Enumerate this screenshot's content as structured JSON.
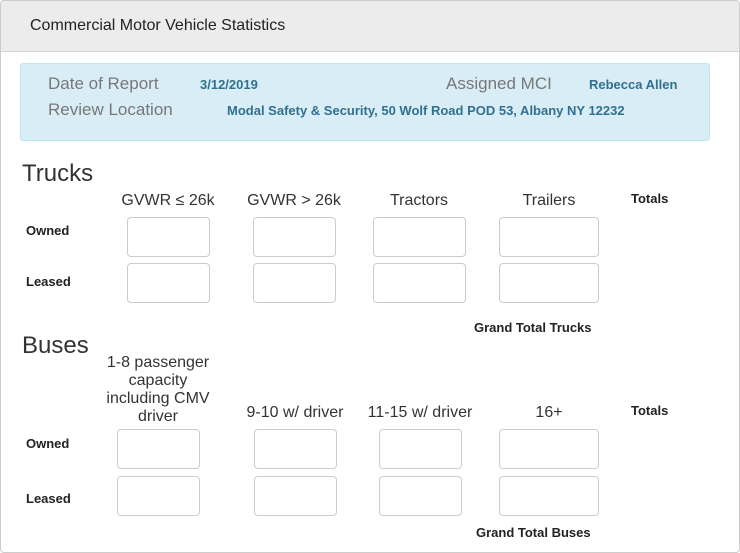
{
  "title": "Commercial Motor Vehicle Statistics",
  "info": {
    "date_label": "Date of Report",
    "date_value": "3/12/2019",
    "mci_label": "Assigned MCI",
    "mci_value": "Rebecca Allen",
    "location_label": "Review Location",
    "location_value": "Modal Safety & Security, 50 Wolf Road POD 53, Albany NY 12232"
  },
  "trucks": {
    "heading": "Trucks",
    "columns": [
      "GVWR ≤ 26k",
      "GVWR > 26k",
      "Tractors",
      "Trailers"
    ],
    "totals": "Totals",
    "rows": [
      "Owned",
      "Leased"
    ],
    "grand_total": "Grand Total Trucks"
  },
  "buses": {
    "heading": "Buses",
    "columns": [
      "1-8 passenger capacity including CMV driver",
      "9-10 w/ driver",
      "11-15 w/ driver",
      "16+"
    ],
    "totals": "Totals",
    "rows": [
      "Owned",
      "Leased"
    ],
    "grand_total": "Grand Total Buses"
  }
}
